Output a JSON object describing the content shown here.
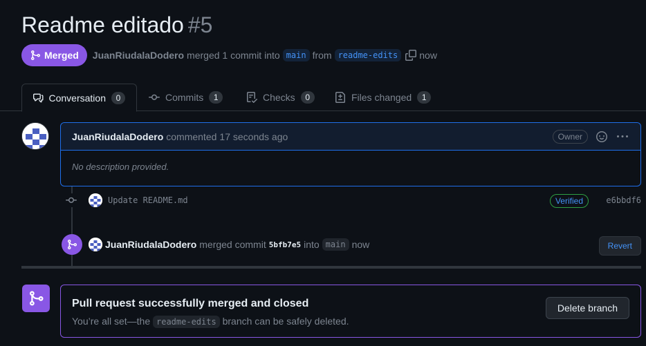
{
  "pr": {
    "title": "Readme editado",
    "number": "#5"
  },
  "status": {
    "badge": "Merged",
    "author": "JuanRiudalaDodero",
    "text_merged": "merged 1 commit into",
    "base_branch": "main",
    "text_from": "from",
    "head_branch": "readme-edits",
    "time": "now"
  },
  "tabs": [
    {
      "label": "Conversation",
      "count": "0"
    },
    {
      "label": "Commits",
      "count": "1"
    },
    {
      "label": "Checks",
      "count": "0"
    },
    {
      "label": "Files changed",
      "count": "1"
    }
  ],
  "comment": {
    "author": "JuanRiudalaDodero",
    "action": "commented",
    "time": "17 seconds ago",
    "role": "Owner",
    "body": "No description provided."
  },
  "commit": {
    "message": "Update README.md",
    "verified": "Verified",
    "sha": "e6bbdf6"
  },
  "merge_event": {
    "author": "JuanRiudalaDodero",
    "text": "merged commit",
    "sha": "5bfb7e5",
    "into": "into",
    "branch": "main",
    "time": "now",
    "revert_label": "Revert"
  },
  "merged_panel": {
    "heading": "Pull request successfully merged and closed",
    "desc_prefix": "You’re all set—the",
    "branch": "readme-edits",
    "desc_suffix": "branch can be safely deleted.",
    "delete_label": "Delete branch"
  },
  "colors": {
    "merged": "#8957e5",
    "accent_blue": "#4493f8",
    "background": "#0d1117"
  },
  "icons": [
    "git-merge-icon",
    "copy-icon",
    "comment-discussion-icon",
    "git-commit-icon",
    "checklist-icon",
    "file-diff-icon",
    "smiley-icon",
    "kebab-horizontal-icon"
  ]
}
